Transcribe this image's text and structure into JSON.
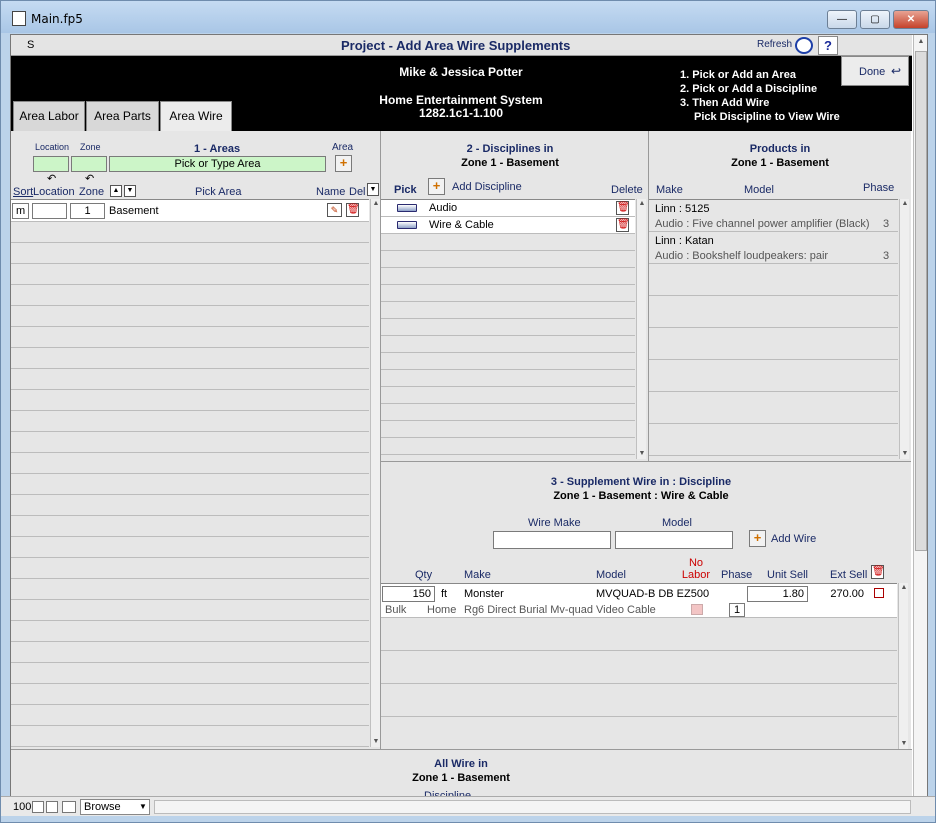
{
  "window": {
    "title": "Main.fp5",
    "min": "—",
    "max": "▢",
    "close": "✕"
  },
  "header": {
    "s_label": "S",
    "title": "Project - Add Area Wire Supplements",
    "refresh": "Refresh",
    "help": "?"
  },
  "banner": {
    "client": "Mike & Jessica Potter",
    "project": "Home Entertainment System",
    "version": "1282.1c1-1.100",
    "steps": [
      "1. Pick or Add an Area",
      "2. Pick or Add a Discipline",
      "3. Then Add Wire",
      "Pick Discipline to View Wire"
    ],
    "done": "Done"
  },
  "tabs": [
    "Area Labor",
    "Area Parts",
    "Area Wire"
  ],
  "areas": {
    "title": "1 - Areas",
    "location_label": "Location",
    "zone_label": "Zone",
    "area_label": "Area",
    "pick_placeholder": "Pick or Type Area",
    "col_sort": "Sort",
    "col_location": "Location",
    "col_zone": "Zone",
    "col_pick_area": "Pick Area",
    "col_name": "Name",
    "col_del": "Del",
    "rows": [
      {
        "sort": "m",
        "location": "",
        "zone": "1",
        "name": "Basement"
      }
    ]
  },
  "disciplines": {
    "title": "2 - Disciplines in",
    "subtitle": "Zone 1 - Basement",
    "col_pick": "Pick",
    "add_label": "Add Discipline",
    "col_delete": "Delete",
    "rows": [
      {
        "name": "Audio"
      },
      {
        "name": "Wire & Cable"
      }
    ]
  },
  "products": {
    "title": "Products in",
    "subtitle": "Zone 1 - Basement",
    "col_make": "Make",
    "col_model": "Model",
    "col_phase": "Phase",
    "rows": [
      {
        "line1": "Linn : 5125",
        "line2": "Audio : Five channel power amplifier (Black)",
        "phase": "3"
      },
      {
        "line1": "Linn : Katan",
        "line2": "Audio : Bookshelf loudpeakers: pair",
        "phase": "3"
      }
    ]
  },
  "supplement": {
    "title": "3 - Supplement Wire in : Discipline",
    "subtitle": "Zone 1 - Basement : Wire & Cable",
    "wire_make_label": "Wire Make",
    "model_label": "Model",
    "add_wire": "Add  Wire",
    "col_qty": "Qty",
    "col_make": "Make",
    "col_model": "Model",
    "col_nolabor": "No\nLabor",
    "col_phase": "Phase",
    "col_unit_sell": "Unit Sell",
    "col_ext_sell": "Ext Sell",
    "rows": [
      {
        "qty": "150",
        "unit": "ft",
        "make": "Monster",
        "model": "MVQUAD-B DB EZ500",
        "unit_sell": "1.80",
        "ext_sell": "270.00",
        "type": "Bulk",
        "location": "Home",
        "description": "Rg6 Direct Burial Mv-quad Video Cable",
        "phase": "1"
      }
    ]
  },
  "footer": {
    "title": "All Wire in",
    "subtitle": "Zone 1 - Basement",
    "discipline": "Discipline"
  },
  "status": {
    "zoom": "100",
    "mode": "Browse"
  }
}
